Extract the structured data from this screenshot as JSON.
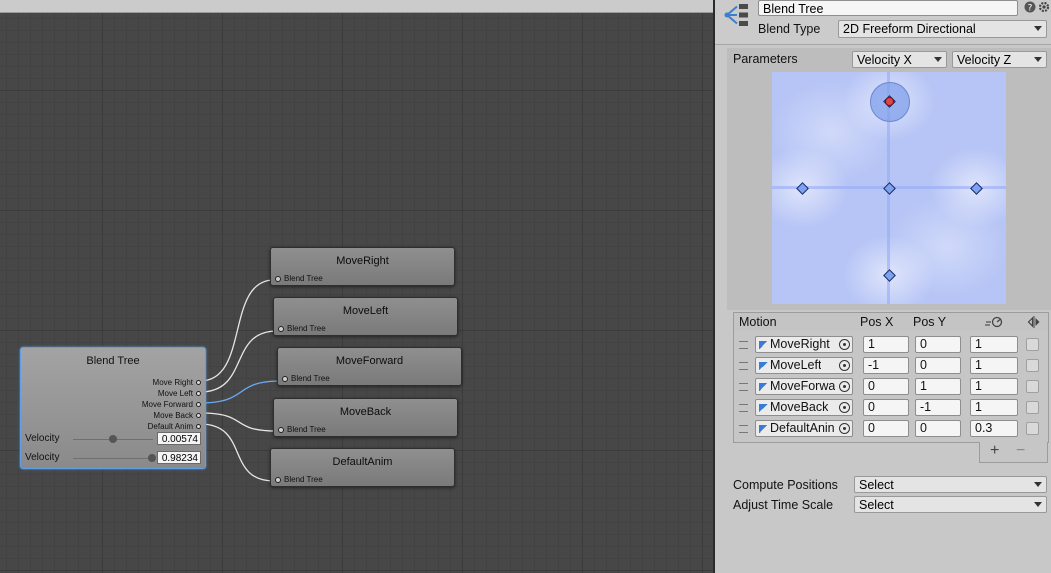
{
  "graph": {
    "blend_node": {
      "title": "Blend Tree",
      "outputs": [
        "Move Right",
        "Move Left",
        "Move Forward",
        "Move Back",
        "Default Anim"
      ],
      "params": [
        {
          "label": "Velocity",
          "value": "0.00574",
          "slider": 0.5
        },
        {
          "label": "Velocity",
          "value": "0.98234",
          "slider": 0.99
        }
      ]
    },
    "child_nodes": [
      {
        "title": "MoveRight",
        "port": "Blend Tree"
      },
      {
        "title": "MoveLeft",
        "port": "Blend Tree"
      },
      {
        "title": "MoveForward",
        "port": "Blend Tree"
      },
      {
        "title": "MoveBack",
        "port": "Blend Tree"
      },
      {
        "title": "DefaultAnim",
        "port": "Blend Tree"
      }
    ]
  },
  "inspector": {
    "name_value": "Blend Tree",
    "blend_type_label": "Blend Type",
    "blend_type_value": "2D Freeform Directional",
    "parameters_label": "Parameters",
    "param_x": "Velocity X",
    "param_y": "Velocity Z",
    "viz": {
      "current": {
        "x": 0.0,
        "y": 1.0
      },
      "points": [
        {
          "x": 1,
          "y": 0
        },
        {
          "x": -1,
          "y": 0
        },
        {
          "x": 0,
          "y": 1
        },
        {
          "x": 0,
          "y": -1
        },
        {
          "x": 0,
          "y": 0
        }
      ]
    },
    "motion_table": {
      "headers": {
        "motion": "Motion",
        "posx": "Pos X",
        "posy": "Pos Y"
      },
      "rows": [
        {
          "motion": "MoveRight",
          "posx": "1",
          "posy": "0",
          "speed": "1"
        },
        {
          "motion": "MoveLeft",
          "posx": "-1",
          "posy": "0",
          "speed": "1"
        },
        {
          "motion": "MoveForwa",
          "posx": "0",
          "posy": "1",
          "speed": "1"
        },
        {
          "motion": "MoveBack",
          "posx": "0",
          "posy": "-1",
          "speed": "1"
        },
        {
          "motion": "DefaultAnin",
          "posx": "0",
          "posy": "0",
          "speed": "0.3"
        }
      ],
      "add_label": "+",
      "remove_label": "−"
    },
    "compute_positions_label": "Compute Positions",
    "compute_positions_value": "Select",
    "adjust_time_scale_label": "Adjust Time Scale",
    "adjust_time_scale_value": "Select"
  },
  "colors": {
    "accent": "#5ea0e8",
    "viz_bg": "#b7c5f6",
    "current_point": "#e04545"
  }
}
